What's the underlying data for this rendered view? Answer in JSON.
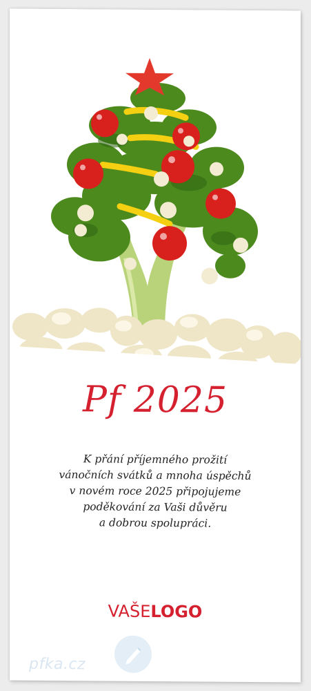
{
  "title": "Pf 2025",
  "message": [
    "K přání příjemného prožití",
    "vánočních svátků a mnoha úspěchů",
    "v novém roce 2025 připojujeme",
    "poděkování za Vaši důvěru",
    "a dobrou spolupráci."
  ],
  "logo": {
    "light": "VAŠE",
    "bold": "LOGO"
  },
  "watermark": "pfka.cz",
  "colors": {
    "accent": "#d5202f",
    "broccoli": "#4d8a1e",
    "cauliflower": "#f1ead1",
    "tomato": "#d8201c",
    "pepper": "#f4cf12"
  },
  "image": {
    "icons": [
      "broccoli-tree-photo",
      "star-icon",
      "pen-icon"
    ]
  }
}
